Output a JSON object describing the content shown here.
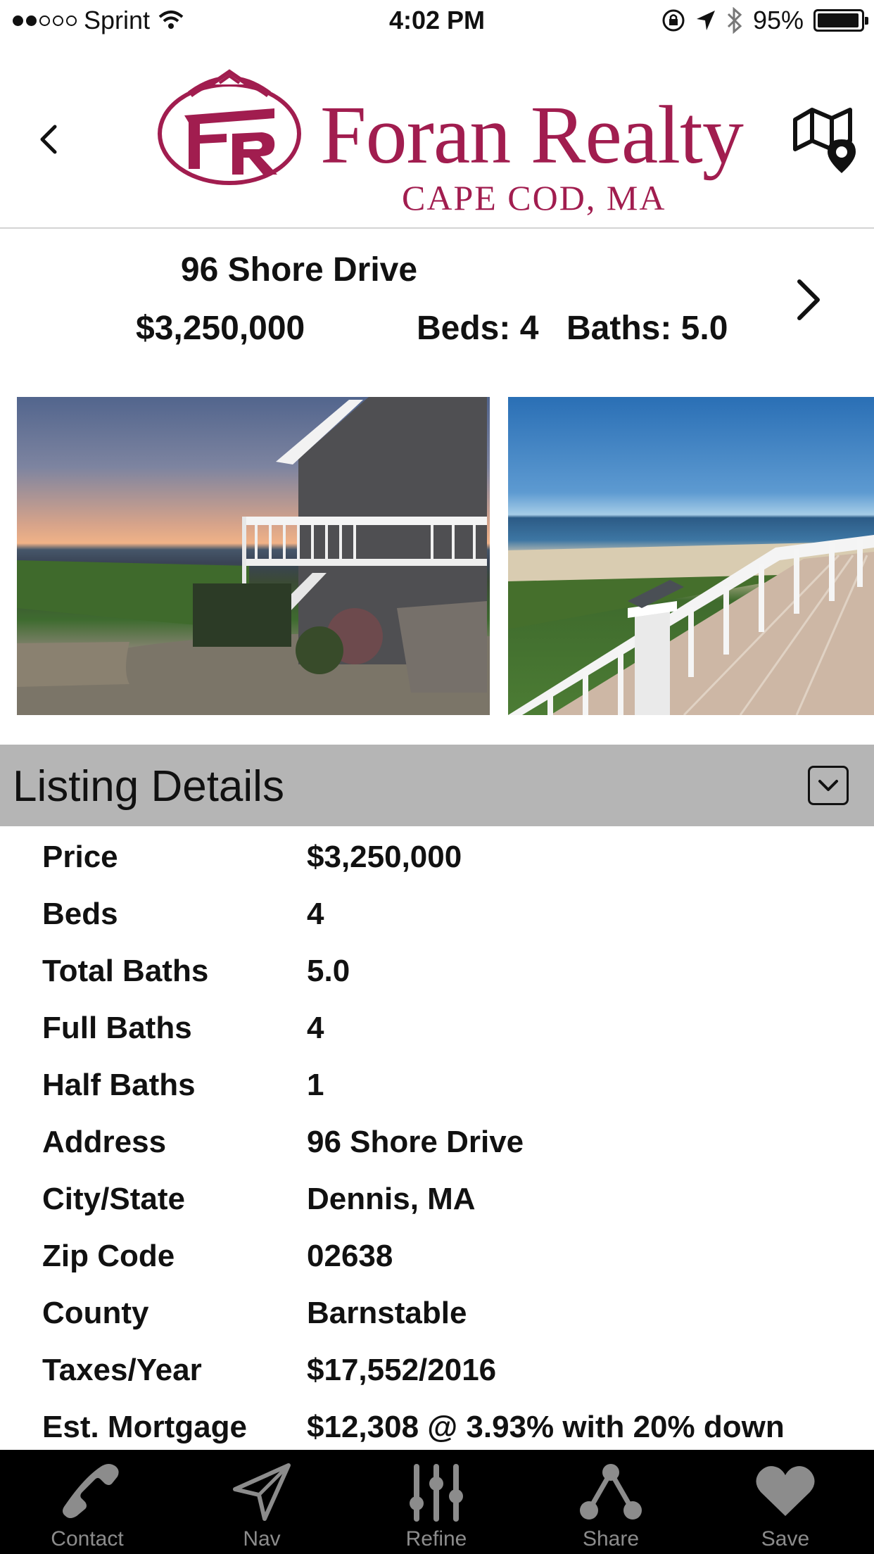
{
  "status_bar": {
    "carrier": "Sprint",
    "time": "4:02 PM",
    "battery": "95%",
    "signal_bars": 2
  },
  "header": {
    "brand_name": "Foran Realty",
    "brand_location": "CAPE COD, MA",
    "brand_color": "#a11d4f",
    "logo_monogram": "FR"
  },
  "summary": {
    "address": "96 Shore Drive",
    "price": "$3,250,000",
    "beds": "Beds: 4",
    "baths": "Baths: 5.0"
  },
  "photos": {
    "items": [
      "house-sunset-photo",
      "deck-ocean-view-photo"
    ]
  },
  "listing_details": {
    "title": "Listing Details",
    "rows": [
      {
        "label": "Price",
        "value": "$3,250,000"
      },
      {
        "label": "Beds",
        "value": "4"
      },
      {
        "label": "Total Baths",
        "value": "5.0"
      },
      {
        "label": "Full Baths",
        "value": "4"
      },
      {
        "label": "Half Baths",
        "value": "1"
      },
      {
        "label": "Address",
        "value": "96 Shore Drive"
      },
      {
        "label": "City/State",
        "value": "Dennis, MA"
      },
      {
        "label": "Zip Code",
        "value": "02638"
      },
      {
        "label": "County",
        "value": "Barnstable"
      },
      {
        "label": "Taxes/Year",
        "value": "$17,552/2016"
      },
      {
        "label": "Est. Mortgage",
        "value": "$12,308 @ 3.93% with 20% down"
      }
    ]
  },
  "tab_bar": {
    "tabs": [
      {
        "label": "Contact",
        "icon": "phone-icon"
      },
      {
        "label": "Nav",
        "icon": "navigation-arrow-icon"
      },
      {
        "label": "Refine",
        "icon": "sliders-icon"
      },
      {
        "label": "Share",
        "icon": "share-icon"
      },
      {
        "label": "Save",
        "icon": "heart-icon"
      }
    ]
  }
}
